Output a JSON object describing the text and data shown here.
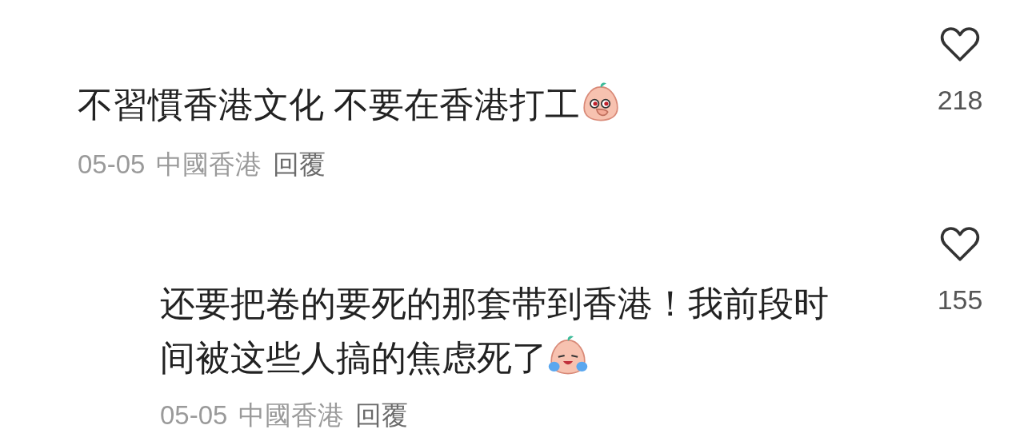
{
  "comments": [
    {
      "text": "不習慣香港文化 不要在香港打工",
      "sticker": {
        "kind": "hand-over-mouth"
      },
      "date": "05-05",
      "location": "中國香港",
      "reply_label": "回覆",
      "likes": "218",
      "liked": false,
      "replies": [
        {
          "text": "还要把卷的要死的那套带到香港！我前段时间被这些人搞的焦虑死了",
          "sticker": {
            "kind": "crying"
          },
          "date": "05-05",
          "location": "中國香港",
          "reply_label": "回覆",
          "likes": "155",
          "liked": false
        }
      ]
    }
  ]
}
